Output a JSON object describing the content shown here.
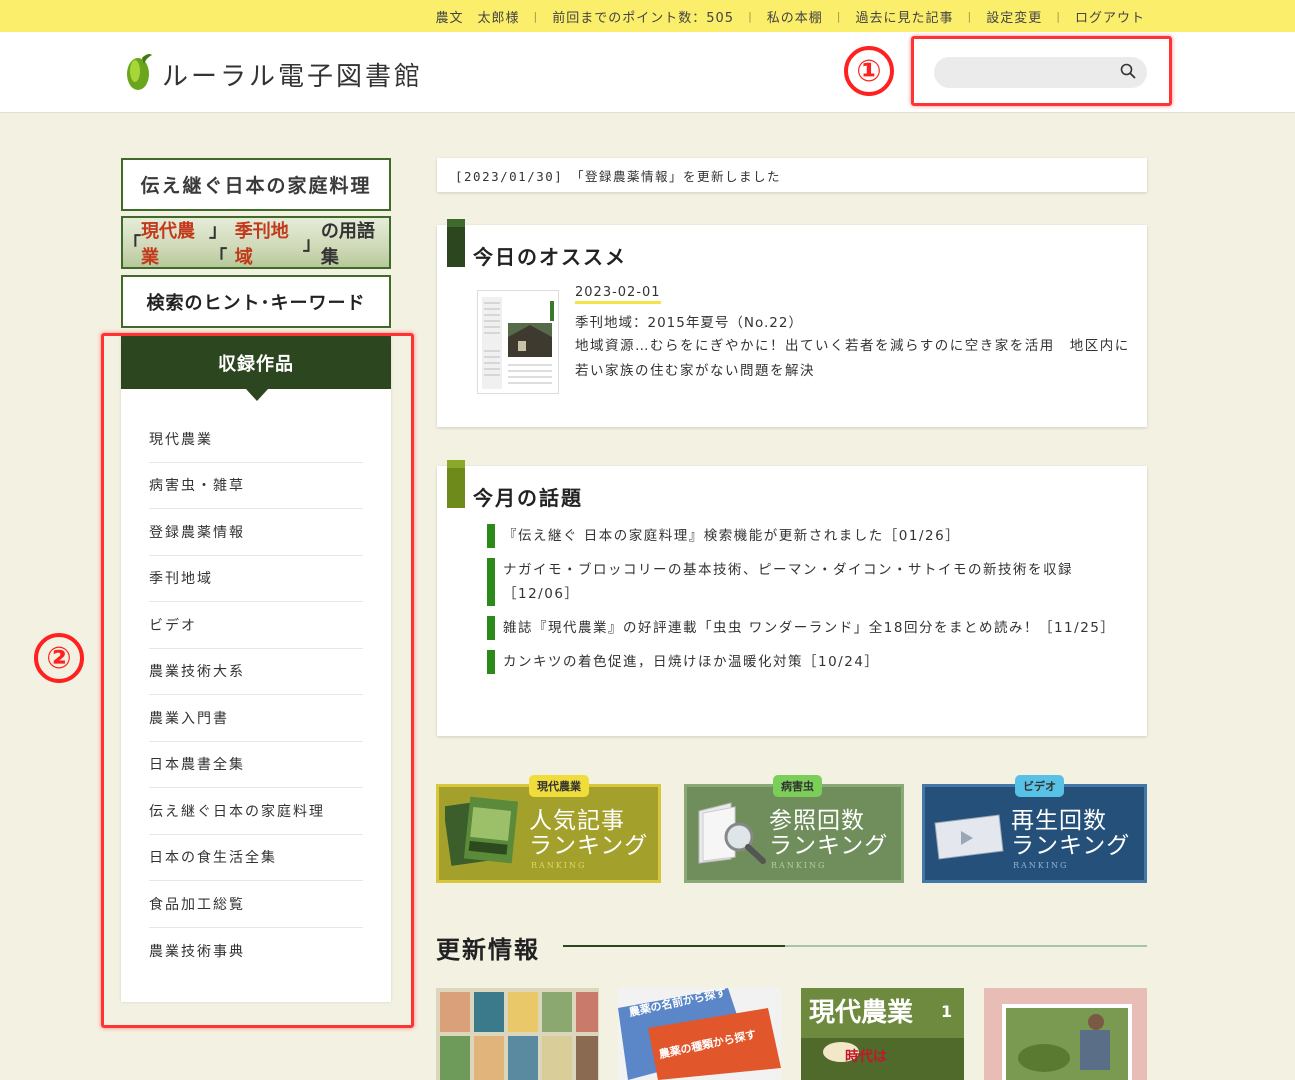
{
  "topbar": {
    "items": [
      {
        "label": "農文　太郎様"
      },
      {
        "label": "前回までのポイント数：505"
      },
      {
        "label": "私の本棚"
      },
      {
        "label": "過去に見た記事"
      },
      {
        "label": "設定変更"
      },
      {
        "label": "ログアウト"
      }
    ]
  },
  "header": {
    "site_name": "ルーラル電子図書館",
    "search": {
      "value": "",
      "placeholder": ""
    }
  },
  "annotations": {
    "one": "①",
    "two": "②"
  },
  "banners": {
    "traditional": "伝え継ぐ日本の家庭料理",
    "glossary": {
      "q1": "「",
      "hl1": "現代農業",
      "mid": "」「",
      "hl2": "季刊地域",
      "q2": "」",
      "suffix": "の用語集"
    },
    "hints": "検索のヒント･キーワード"
  },
  "collection": {
    "title": "収録作品",
    "items": [
      "現代農業",
      "病害虫・雑草",
      "登録農薬情報",
      "季刊地域",
      "ビデオ",
      "農業技術大系",
      "農業入門書",
      "日本農書全集",
      "伝え継ぐ日本の家庭料理",
      "日本の食生活全集",
      "食品加工総覧",
      "農業技術事典"
    ]
  },
  "notice": "[2023/01/30]　「登録農薬情報」を更新しました",
  "recommend": {
    "title": "今日のオススメ",
    "date": "2023-02-01",
    "source": "季刊地域：2015年夏号（No.22）",
    "description": "地域資源…むらをにぎやかに！出ていく若者を減らすのに空き家を活用　地区内に若い家族の住む家がない問題を解決"
  },
  "topics": {
    "title": "今月の話題",
    "items": [
      "『伝え継ぐ 日本の家庭料理』検索機能が更新されました［01/26］",
      "ナガイモ・ブロッコリーの基本技術、ピーマン・ダイコン・サトイモの新技術を収録［12/06］",
      "雑誌『現代農業』の好評連載「虫虫 ワンダーランド」全18回分をまとめ読み！［11/25］",
      "カンキツの着色促進，日焼けほか温暖化対策［10/24］"
    ]
  },
  "rankings": [
    {
      "tag": "現代農業",
      "line1": "人気記事",
      "line2": "ランキング",
      "sub": "RANKING"
    },
    {
      "tag": "病害虫",
      "line1": "参照回数",
      "line2": "ランキング",
      "sub": "RANKING"
    },
    {
      "tag": "ビデオ",
      "line1": "再生回数",
      "line2": "ランキング",
      "sub": "RANKING"
    }
  ],
  "updates": {
    "title": "更新情報",
    "thumbs": [
      {
        "text": ""
      },
      {
        "text1": "農薬の名前から探す",
        "text2": "農薬の種類から探す"
      },
      {
        "text1": "現代農業",
        "text2": "1",
        "text3": "時代は"
      },
      {
        "text": ""
      }
    ]
  },
  "colors": {
    "topbar": "#fbee6b",
    "dark_green": "#2c4620",
    "annotation_red": "#ff2020",
    "background": "#f3f1e1"
  }
}
